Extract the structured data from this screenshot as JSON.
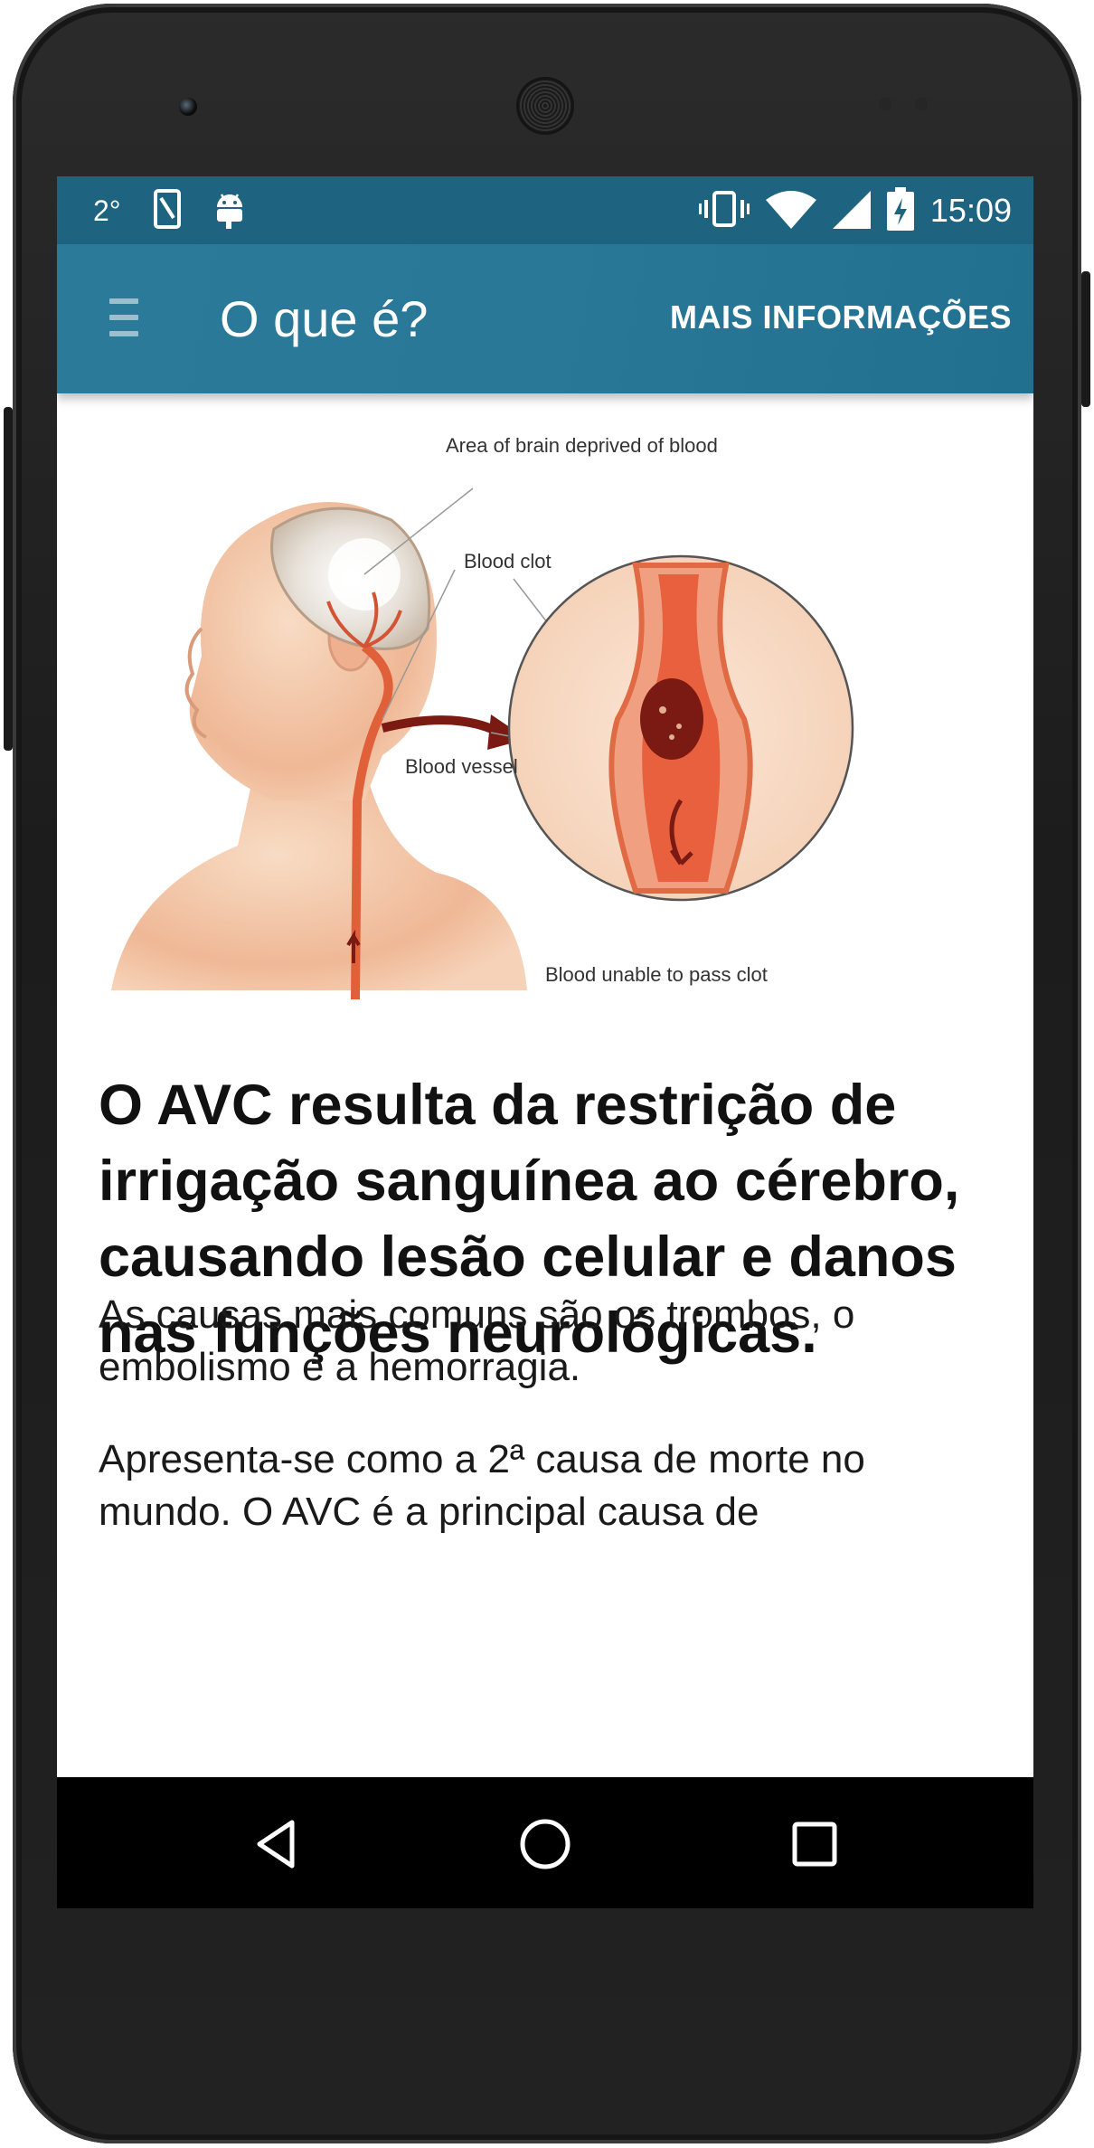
{
  "status_bar": {
    "temperature": "2°",
    "time": "15:09"
  },
  "app_bar": {
    "title": "O que é?",
    "action_label": "MAIS INFORMAÇÕES"
  },
  "illustration": {
    "label_area": "Area of brain deprived of blood",
    "label_clot": "Blood clot",
    "label_vessel": "Blood vessel",
    "label_unable": "Blood unable to pass clot"
  },
  "article": {
    "headline": "O AVC resulta da restrição de irrigação sanguínea ao cérebro, causando lesão celular e danos nas funções neurológicas.",
    "paragraph_1": "As causas mais comuns são os trombos, o embolismo e a hemorragia.",
    "paragraph_2": "Apresenta-se como a 2ª causa de morte no mundo. O AVC é a principal causa de"
  },
  "colors": {
    "status_bar": "#1e6480",
    "app_bar": "#2a7898",
    "text": "#111111",
    "skin": "#f3c8a8",
    "artery": "#e0603a",
    "clot": "#7a1a12"
  },
  "icons": {
    "status_left": [
      "temperature-text",
      "sim-card-icon",
      "android-icon"
    ],
    "status_right": [
      "vibrate-icon",
      "wifi-icon",
      "cell-signal-icon",
      "battery-charging-icon"
    ],
    "app_bar": [
      "menu-icon"
    ],
    "nav": [
      "back-icon",
      "home-icon",
      "recents-icon"
    ]
  }
}
